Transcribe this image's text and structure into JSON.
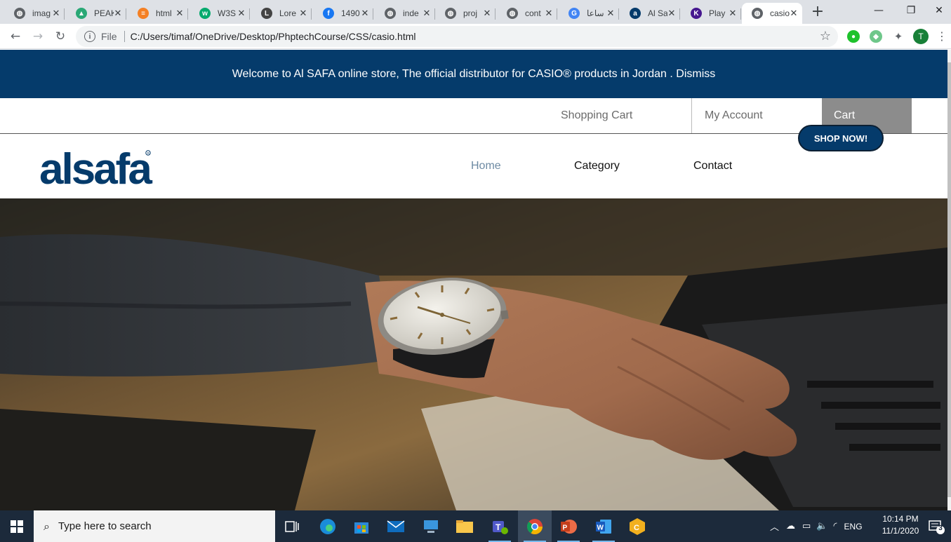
{
  "browser": {
    "tabs": [
      {
        "label": "imag",
        "icon": "globe-icon"
      },
      {
        "label": "PEAK",
        "icon": "peak-icon"
      },
      {
        "label": "html",
        "icon": "stackoverflow-icon"
      },
      {
        "label": "W3S",
        "icon": "w3schools-icon"
      },
      {
        "label": "Lore",
        "icon": "lorem-icon"
      },
      {
        "label": "1490",
        "icon": "facebook-icon"
      },
      {
        "label": "inde",
        "icon": "globe-icon"
      },
      {
        "label": "proj",
        "icon": "globe-icon"
      },
      {
        "label": "cont",
        "icon": "globe-icon"
      },
      {
        "label": "ساعا",
        "icon": "google-icon"
      },
      {
        "label": "Al Sa",
        "icon": "alsafa-icon"
      },
      {
        "label": "Play",
        "icon": "kahoot-icon"
      },
      {
        "label": "casio",
        "icon": "globe-icon",
        "active": true
      }
    ],
    "address": {
      "scheme_label": "File",
      "url": "C:/Users/timaf/OneDrive/Desktop/PhptechCourse/CSS/casio.html"
    },
    "profile_initial": "T"
  },
  "page": {
    "announcement": {
      "text": "Welcome to Al SAFA online store, The official distributor for CASIO® products in Jordan . ",
      "dismiss": "Dismiss"
    },
    "top_nav": {
      "shopping_cart": "Shopping Cart",
      "my_account": "My Account",
      "cart": "Cart"
    },
    "logo_text": "alsafa",
    "main_nav": {
      "home": "Home",
      "category": "Category",
      "contact": "Contact",
      "shop_now": "SHOP NOW!"
    },
    "colors": {
      "brand_navy": "#053b6b",
      "cart_gray": "#8c8c8c",
      "home_link": "#6d8aa3"
    }
  },
  "taskbar": {
    "search_placeholder": "Type here to search",
    "language": "ENG",
    "time": "10:14 PM",
    "date": "11/1/2020",
    "notification_count": "3"
  }
}
